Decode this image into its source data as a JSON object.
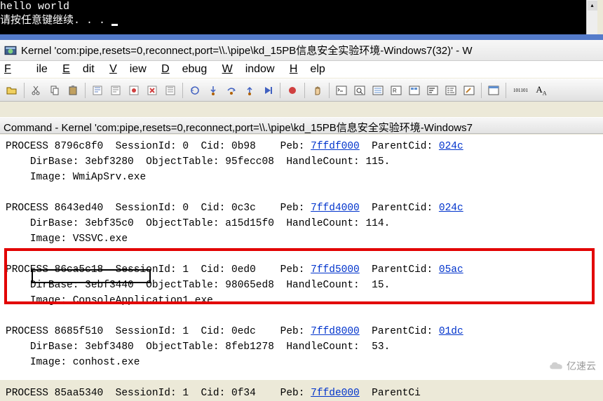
{
  "console": {
    "line1": "hello world",
    "line2": "请按任意键继续. . ."
  },
  "window": {
    "title": "Kernel 'com:pipe,resets=0,reconnect,port=\\\\.\\pipe\\kd_15PB信息安全实验环境-Windows7(32)' - W"
  },
  "menu": {
    "file": "File",
    "edit": "Edit",
    "view": "View",
    "debug": "Debug",
    "window": "Window",
    "help": "Help"
  },
  "cmdwin": {
    "title": "Command - Kernel 'com:pipe,resets=0,reconnect,port=\\\\.\\pipe\\kd_15PB信息安全实验环境-Windows7"
  },
  "processes": [
    {
      "addr": "8796c8f0",
      "session": "0",
      "cid": "0b98",
      "peb": "7ffdf000",
      "parentcid": "024c",
      "dirbase": "3ebf3280",
      "objtable": "95fecc08",
      "handlecount": "115",
      "image": "WmiApSrv.exe"
    },
    {
      "addr": "8643ed40",
      "session": "0",
      "cid": "0c3c",
      "peb": "7ffd4000",
      "parentcid": "024c",
      "dirbase": "3ebf35c0",
      "objtable": "a15d15f0",
      "handlecount": "114",
      "image": "VSSVC.exe"
    },
    {
      "addr": "86ca5c18",
      "session": "1",
      "cid": "0ed0",
      "peb": "7ffd5000",
      "parentcid": "05ac",
      "dirbase": "3ebf3440",
      "objtable": "98065ed8",
      "handlecount": "15",
      "image": "ConsoleApplication1.exe"
    },
    {
      "addr": "8685f510",
      "session": "1",
      "cid": "0edc",
      "peb": "7ffd8000",
      "parentcid": "01dc",
      "dirbase": "3ebf3480",
      "objtable": "8feb1278",
      "handlecount": "53",
      "image": "conhost.exe"
    },
    {
      "addr": "85aa5340",
      "session": "1",
      "peb": "7ffde000"
    }
  ],
  "labels": {
    "process": "PROCESS",
    "session": "SessionId:",
    "cid": "Cid:",
    "peb": "Peb:",
    "parentcid": "ParentCid:",
    "parentci": "ParentCi",
    "dirbase": "DirBase:",
    "objtable": "ObjectTable:",
    "handlecount": "HandleCount:",
    "image": "Image:"
  },
  "watermark": "亿速云",
  "toolbar_icons": [
    "open",
    "cut",
    "copy",
    "paste",
    "props",
    "blank1",
    "blank2",
    "marker",
    "blank3",
    "restart",
    "stop",
    "break",
    "step-into",
    "step-over",
    "step-out",
    "run-to",
    "hand",
    "source",
    "disasm",
    "blank4",
    "call",
    "break-go",
    "blank5",
    "registers",
    "memory",
    "font"
  ]
}
